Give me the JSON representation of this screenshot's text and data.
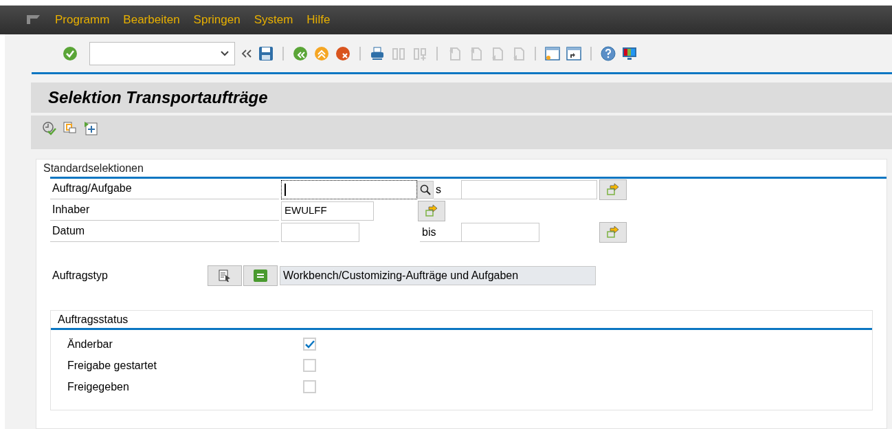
{
  "menu": [
    "Programm",
    "Bearbeiten",
    "Springen",
    "System",
    "Hilfe"
  ],
  "title": "Selektion Transportaufträge",
  "standard": {
    "title": "Standardselektionen",
    "rows": [
      {
        "kind": "range",
        "label": "Auftrag/Aufgabe",
        "from": "",
        "to_label": "s",
        "to": "",
        "focused": true
      },
      {
        "kind": "single",
        "label": "Inhaber",
        "from": "EWULFF",
        "focused": false
      },
      {
        "kind": "range",
        "label": "Datum",
        "from": "",
        "to_label": "bis",
        "to": "",
        "focused": false
      }
    ],
    "type_label": "Auftragstyp",
    "type_value": "Workbench/Customizing-Aufträge und Aufgaben"
  },
  "status": {
    "title": "Auftragsstatus",
    "items": [
      {
        "label": "Änderbar",
        "checked": true
      },
      {
        "label": "Freigabe gestartet",
        "checked": false
      },
      {
        "label": "Freigegeben",
        "checked": false
      }
    ]
  }
}
